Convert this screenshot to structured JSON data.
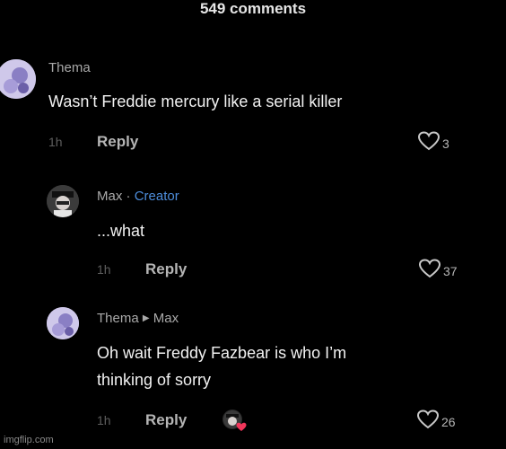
{
  "header": {
    "title": "549 comments"
  },
  "comments": [
    {
      "username": "Thema",
      "text": "Wasn’t Freddie mercury like a serial killer",
      "time": "1h",
      "reply_label": "Reply",
      "likes": "3"
    },
    {
      "username": "Max",
      "separator": "·",
      "badge": "Creator",
      "text": "...what",
      "time": "1h",
      "reply_label": "Reply",
      "likes": "37"
    },
    {
      "username": "Thema",
      "reply_to": "Max",
      "text_line1": "Oh wait Freddy Fazbear is who I’m",
      "text_line2": "thinking of sorry",
      "time": "1h",
      "reply_label": "Reply",
      "likes": "26"
    }
  ],
  "watermark": "imgflip.com",
  "icons": {
    "like": "heart-outline-icon",
    "creator_liked": "creator-liked-icon"
  },
  "colors": {
    "background": "#000000",
    "creator_badge": "#4d8ddb"
  }
}
